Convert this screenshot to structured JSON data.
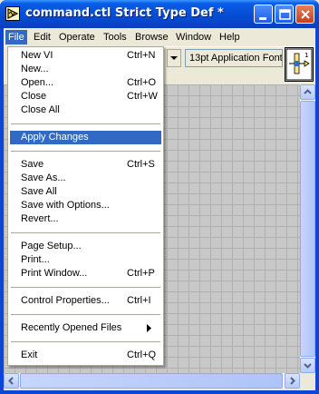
{
  "window": {
    "title": "command.ctl Strict Type Def *"
  },
  "menubar": [
    "File",
    "Edit",
    "Operate",
    "Tools",
    "Browse",
    "Window",
    "Help"
  ],
  "toolbar": {
    "font_label": "13pt Application Font"
  },
  "file_menu": {
    "items": [
      {
        "label": "New VI",
        "shortcut": "Ctrl+N"
      },
      {
        "label": "New...",
        "shortcut": ""
      },
      {
        "label": "Open...",
        "shortcut": "Ctrl+O"
      },
      {
        "label": "Close",
        "shortcut": "Ctrl+W"
      },
      {
        "label": "Close All",
        "shortcut": ""
      },
      {
        "label": "Apply Changes",
        "shortcut": ""
      },
      {
        "label": "Save",
        "shortcut": "Ctrl+S"
      },
      {
        "label": "Save As...",
        "shortcut": ""
      },
      {
        "label": "Save All",
        "shortcut": ""
      },
      {
        "label": "Save with Options...",
        "shortcut": ""
      },
      {
        "label": "Revert...",
        "shortcut": ""
      },
      {
        "label": "Page Setup...",
        "shortcut": ""
      },
      {
        "label": "Print...",
        "shortcut": ""
      },
      {
        "label": "Print Window...",
        "shortcut": "Ctrl+P"
      },
      {
        "label": "Control Properties...",
        "shortcut": "Ctrl+I"
      },
      {
        "label": "Recently Opened Files",
        "shortcut": ""
      },
      {
        "label": "Exit",
        "shortcut": "Ctrl+Q"
      }
    ],
    "highlighted": "Apply Changes"
  },
  "colors": {
    "titlebar": "#0a46d8",
    "highlight": "#316ac5",
    "canvas": "#c8c8c8"
  },
  "icons": [
    "labview-app-icon",
    "minimize-icon",
    "maximize-icon",
    "close-icon",
    "connector-pane-icon",
    "submenu-arrow-icon",
    "scroll-up-icon",
    "scroll-down-icon",
    "scroll-left-icon",
    "scroll-right-icon"
  ]
}
